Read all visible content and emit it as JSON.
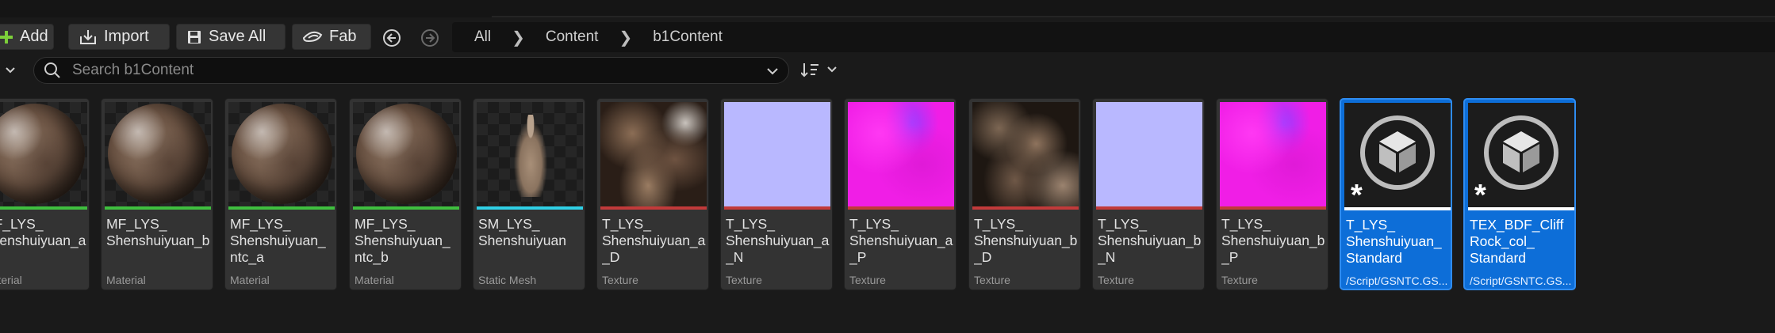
{
  "toolbar": {
    "add_label": "Add",
    "import_label": "Import",
    "save_all_label": "Save All",
    "fab_label": "Fab"
  },
  "breadcrumb": [
    "All",
    "Content",
    "b1Content"
  ],
  "search": {
    "placeholder": "Search b1Content"
  },
  "colors": {
    "material_bar": "#3fbf3f",
    "static_mesh_bar": "#2fd0e6",
    "texture_bar": "#c23a3a",
    "selected_bg": "#0d6ed8",
    "add_icon": "#7ccf3a"
  },
  "assets": [
    {
      "name": "MF_LYS_\nShenshuiyuan_a",
      "type": "Material",
      "thumb": "sphere",
      "bar": "material"
    },
    {
      "name": "MF_LYS_\nShenshuiyuan_b",
      "type": "Material",
      "thumb": "sphere",
      "bar": "material"
    },
    {
      "name": "MF_LYS_\nShenshuiyuan_\nntc_a",
      "type": "Material",
      "thumb": "sphere",
      "bar": "material"
    },
    {
      "name": "MF_LYS_\nShenshuiyuan_\nntc_b",
      "type": "Material",
      "thumb": "sphere",
      "bar": "material"
    },
    {
      "name": "SM_LYS_\nShenshuiyuan",
      "type": "Static Mesh",
      "thumb": "statue",
      "bar": "static_mesh"
    },
    {
      "name": "T_LYS_\nShenshuiyuan_a\n_D",
      "type": "Texture",
      "thumb": "rockA",
      "bar": "texture"
    },
    {
      "name": "T_LYS_\nShenshuiyuan_a\n_N",
      "type": "Texture",
      "thumb": "normal",
      "bar": "texture"
    },
    {
      "name": "T_LYS_\nShenshuiyuan_a\n_P",
      "type": "Texture",
      "thumb": "packed",
      "bar": "texture"
    },
    {
      "name": "T_LYS_\nShenshuiyuan_b\n_D",
      "type": "Texture",
      "thumb": "rockB",
      "bar": "texture"
    },
    {
      "name": "T_LYS_\nShenshuiyuan_b\n_N",
      "type": "Texture",
      "thumb": "normal",
      "bar": "texture"
    },
    {
      "name": "T_LYS_\nShenshuiyuan_b\n_P",
      "type": "Texture",
      "thumb": "packed",
      "bar": "texture"
    },
    {
      "name": "T_LYS_\nShenshuiyuan_\nStandard",
      "type": "/Script/GSNTC.GS...",
      "thumb": "cube",
      "bar": "white",
      "selected": true
    },
    {
      "name": "TEX_BDF_Cliff\nRock_col_\nStandard",
      "type": "/Script/GSNTC.GS...",
      "thumb": "cube",
      "bar": "white",
      "selected": true
    }
  ]
}
